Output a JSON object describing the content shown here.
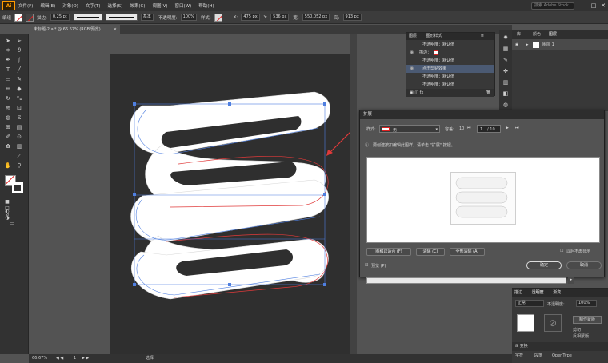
{
  "menubar": {
    "logo": "Ai",
    "items": [
      "文件(F)",
      "编辑(E)",
      "对象(O)",
      "文字(T)",
      "选择(S)",
      "效果(C)",
      "视图(V)",
      "窗口(W)",
      "帮助(H)"
    ],
    "search_placeholder": "搜索 Adobe Stock",
    "window_buttons": [
      "–",
      "□",
      "✕"
    ]
  },
  "controlbar": {
    "selection_label": "编组",
    "stroke_label": "描边:",
    "stroke_value": "0.25 pt",
    "stroke_style": "基本",
    "opacity_label": "不透明度:",
    "opacity_value": "100%",
    "style_label": "样式:",
    "x_label": "X:",
    "x_value": "475 px",
    "y_label": "Y:",
    "y_value": "536 px",
    "w_label": "宽:",
    "w_value": "550.052 px",
    "h_label": "高:",
    "h_value": "913 px"
  },
  "document_tab": {
    "title": "未标题-2.ai* @ 66.67% (RGB/预览)",
    "close": "✕"
  },
  "statusbar": {
    "zoom": "66.67%",
    "page": "1",
    "mode": "选择"
  },
  "layers_panel": {
    "tabs": [
      "图层",
      "图形样式"
    ],
    "rows": [
      {
        "label": "不透明度：默认值"
      },
      {
        "label": "描边：",
        "value": "0 pt"
      },
      {
        "label": "不透明度：默认值"
      },
      {
        "label": "点击剪贴效果"
      },
      {
        "label": "不透明度：默认值"
      },
      {
        "label": "不透明度：默认值"
      }
    ]
  },
  "right_panel": {
    "tabs": [
      "库",
      "颜色",
      "图层"
    ],
    "layer_name": "图层 1",
    "bottom_tabs": [
      "描边",
      "透明度",
      "渐变"
    ],
    "blend_mode": "正常",
    "opacity_label": "不透明度:",
    "opacity_value": "100%",
    "make_mask": "制作蒙版",
    "clip_label": "剪切",
    "invert_label": "反相蒙版",
    "char_tabs": [
      "字符",
      "段落",
      "OpenType"
    ],
    "transform_label": "变换"
  },
  "dialog": {
    "title": "扩展",
    "preset_label": "样式:",
    "preset_value": "无",
    "tolerance_label": "容差:",
    "tolerance_value": "10",
    "count_value": "1",
    "count_total": "/ 10",
    "hint": "要创建按扣编辑此图样，请单击 \"扩展\" 按钮。",
    "buttons": {
      "fit": "图稿以适合 (F)",
      "clear": "清除 (C)",
      "clear_all": "全部清除 (A)",
      "disable_warning": "以后不再显示",
      "preview": "预览 (P)",
      "ok": "确定",
      "cancel": "取消"
    }
  },
  "colors": {
    "accent": "#1473e6",
    "selection": "#4f7fe0",
    "red_path": "#e03a3a",
    "canvas_dark": "#2f2f2f"
  },
  "icons": [
    "selection-arrow-icon",
    "direct-selection-icon",
    "pen-icon",
    "type-icon",
    "line-icon",
    "rect-icon",
    "brush-icon",
    "pencil-icon",
    "eraser-icon",
    "rotate-icon",
    "scale-icon",
    "warp-icon",
    "eyedropper-icon",
    "blend-icon",
    "symbol-icon",
    "graph-icon",
    "artboard-icon",
    "slice-icon",
    "hand-icon",
    "zoom-icon"
  ]
}
